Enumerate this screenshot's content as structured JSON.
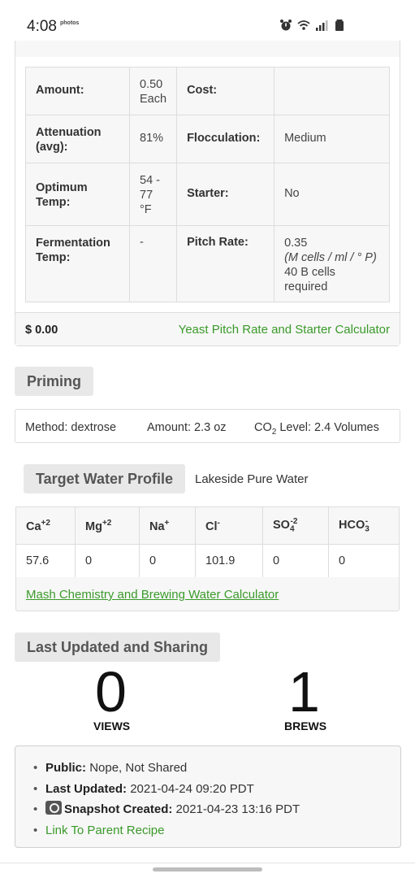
{
  "status_bar": {
    "time": "4:08",
    "photos_badge": "photos",
    "icons": [
      "alarm-icon",
      "wifi-icon",
      "signal-icon",
      "battery-icon"
    ]
  },
  "yeast": {
    "rows": [
      {
        "label1": "Amount:",
        "value1": "0.50 Each",
        "label2": "Cost:",
        "value2": ""
      },
      {
        "label1": "Attenuation (avg):",
        "value1": "81%",
        "label2": "Flocculation:",
        "value2": "Medium"
      },
      {
        "label1": "Optimum Temp:",
        "value1": "54 - 77 °F",
        "label2": "Starter:",
        "value2": "No"
      },
      {
        "label1": "Fermentation Temp:",
        "value1": "-",
        "label2": "Pitch Rate:",
        "value2": "0.35",
        "value2_units": "(M cells / ml / ° P)",
        "value2_extra": "40 B cells required"
      }
    ],
    "price": "$ 0.00",
    "calculator_link": "Yeast Pitch Rate and Starter Calculator"
  },
  "priming": {
    "title": "Priming",
    "method": "Method: dextrose",
    "amount": "Amount: 2.3 oz",
    "co2_prefix": "CO",
    "co2_sub": "2",
    "co2_suffix": " Level: 2.4 Volumes"
  },
  "water": {
    "title": "Target Water Profile",
    "profile_name": "Lakeside Pure Water",
    "headers": [
      {
        "base": "Ca",
        "sup": "+2",
        "sub": ""
      },
      {
        "base": "Mg",
        "sup": "+2",
        "sub": ""
      },
      {
        "base": "Na",
        "sup": "+",
        "sub": ""
      },
      {
        "base": "Cl",
        "sup": "-",
        "sub": ""
      },
      {
        "base": "SO",
        "sub": "4",
        "sup": "-2"
      },
      {
        "base": "HCO",
        "sub": "3",
        "sup": "-"
      }
    ],
    "values": [
      "57.6",
      "0",
      "0",
      "101.9",
      "0",
      "0"
    ],
    "calculator_link": "Mash Chemistry and Brewing Water Calculator"
  },
  "sharing": {
    "title": "Last Updated and Sharing",
    "views_count": "0",
    "views_label": "VIEWS",
    "brews_count": "1",
    "brews_label": "BREWS",
    "public_label": "Public:",
    "public_value": "Nope, Not Shared",
    "updated_label": "Last Updated:",
    "updated_value": "2021-04-24 09:20 PDT",
    "snapshot_label": "Snapshot Created:",
    "snapshot_value": "2021-04-23 13:16 PDT",
    "parent_link": "Link To Parent Recipe"
  }
}
